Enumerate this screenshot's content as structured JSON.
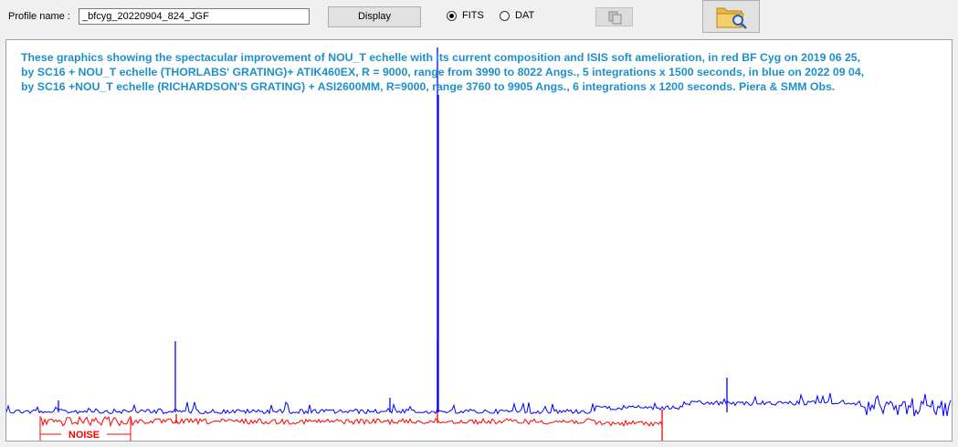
{
  "toolbar": {
    "profile_label": "Profile name :",
    "profile_value": "_bfcyg_20220904_824_JGF",
    "display_label": "Display",
    "radio_fits": "FITS",
    "radio_dat": "DAT",
    "selected_format": "FITS"
  },
  "plot": {
    "caption_lines": [
      "These graphics showing the spectacular improvement of NOU_T echelle with its current composition and ISIS soft amelioration, in red BF Cyg on 2019 06 25,",
      "by SC16 + NOU_T echelle (THORLABS' GRATING)+ ATIK460EX, R = 9000, range from 3990 to 8022 Angs., 5 integrations x 1500 seconds, in blue on 2022 09 04,",
      "by  SC16 +NOU_T echelle  (RICHARDSON'S GRATING) + ASI2600MM, R=9000, range 3760 to 9905 Angs., 6 integrations x 1200 seconds.       Piera & SMM Obs."
    ],
    "noise_label": "NOISE",
    "caption_color": "#1e90c8",
    "blue_color": "#0000ff",
    "red_color": "#ff0000"
  }
}
